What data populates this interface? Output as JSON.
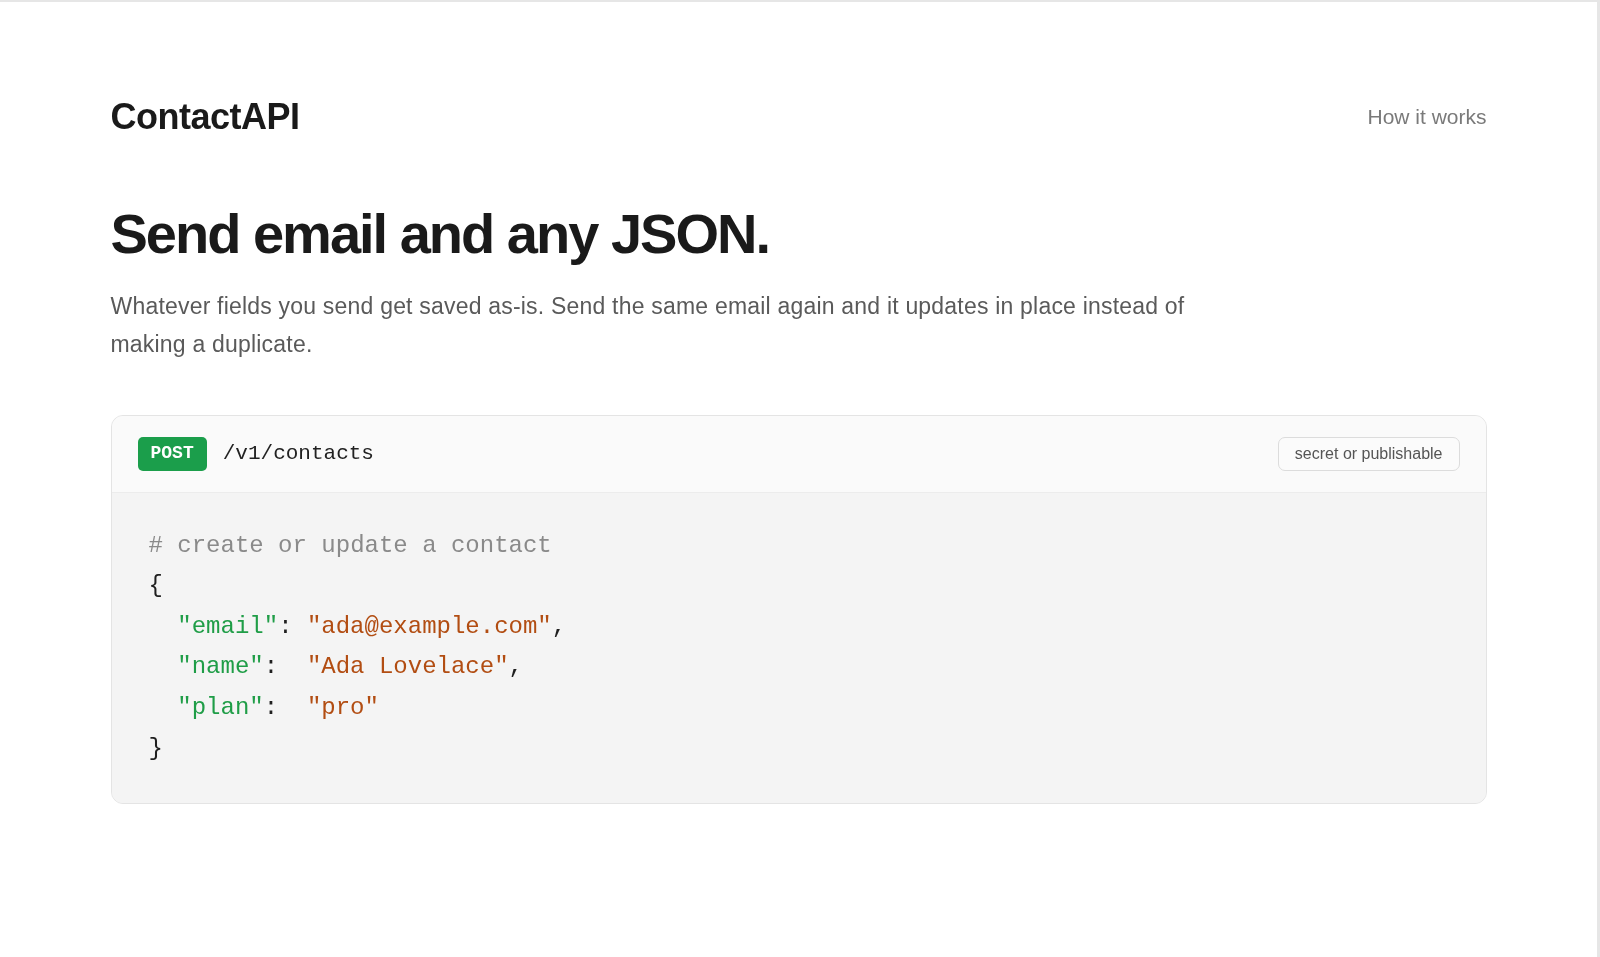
{
  "brand": {
    "name": "ContactAPI"
  },
  "nav": [
    {
      "label": "How it works"
    }
  ],
  "hero": {
    "title": "Send email and any JSON.",
    "description": "Whatever fields you send get saved as-is. Send the same email again and it updates in place instead of making a duplicate."
  },
  "endpoint": {
    "method": "POST",
    "path": "/v1/contacts",
    "key_type": "secret or publishable",
    "code": {
      "comment": "# create or update a contact",
      "open_brace": "{",
      "members": [
        {
          "key": "\"email\"",
          "colon": ":",
          "value": "\"ada@example.com\"",
          "comma": ","
        },
        {
          "key": "\"name\"",
          "colon": ":",
          "value": "\"Ada Lovelace\"",
          "comma": ","
        },
        {
          "key": "\"plan\"",
          "colon": ":",
          "value": "\"pro\""
        }
      ],
      "close_brace": "}"
    }
  }
}
